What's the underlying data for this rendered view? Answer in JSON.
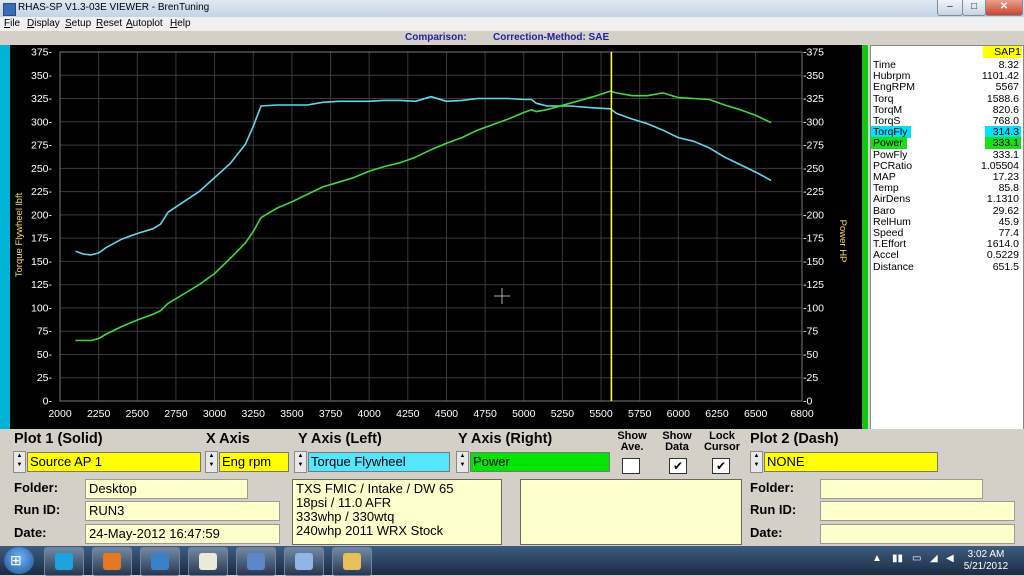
{
  "window": {
    "title": "RHAS-SP V1.3-03E VIEWER - BrenTuning",
    "controls": {
      "minimize": "–",
      "maximize": "□",
      "close": "✕"
    }
  },
  "menu": [
    "File",
    "Display",
    "Setup",
    "Reset",
    "Autoplot",
    "Help"
  ],
  "header": {
    "comparison": "Comparison:",
    "correction": "Correction-Method: SAE"
  },
  "chart_data": {
    "type": "line",
    "ylabel_left": "Torque Flywheel lbft",
    "ylabel_right": "Power HP",
    "xlim": [
      2000,
      6800
    ],
    "ylim": [
      0,
      375
    ],
    "x_ticks": [
      2000,
      2250,
      2500,
      2750,
      3000,
      3250,
      3500,
      3750,
      4000,
      4250,
      4500,
      4750,
      5000,
      5250,
      5500,
      5750,
      6000,
      6250,
      6500,
      6800
    ],
    "y_ticks": [
      0,
      25,
      50,
      75,
      100,
      125,
      150,
      175,
      200,
      225,
      250,
      275,
      300,
      325,
      350,
      375
    ],
    "cursor_x": 5567,
    "grid": true,
    "series": [
      {
        "name": "Torque Flywheel",
        "color": "#5fd7f2",
        "x": [
          2100,
          2150,
          2200,
          2250,
          2300,
          2400,
          2500,
          2600,
          2650,
          2700,
          2800,
          2900,
          3000,
          3100,
          3200,
          3250,
          3300,
          3400,
          3500,
          3600,
          3700,
          3800,
          3900,
          4000,
          4100,
          4200,
          4300,
          4400,
          4500,
          4600,
          4700,
          4800,
          4900,
          5000,
          5050,
          5080,
          5150,
          5300,
          5450,
          5560,
          5600,
          5700,
          5800,
          5900,
          6000,
          6100,
          6200,
          6300,
          6400,
          6500,
          6600
        ],
        "y": [
          161,
          158,
          157,
          159,
          165,
          174,
          180,
          185,
          190,
          203,
          214,
          225,
          240,
          255,
          276,
          295,
          317,
          318,
          318,
          318,
          321,
          322,
          322,
          322,
          323,
          323,
          322,
          327,
          322,
          323,
          325,
          325,
          325,
          324,
          324,
          320,
          317,
          317,
          315,
          314,
          309,
          303,
          298,
          291,
          283,
          279,
          272,
          262,
          254,
          246,
          237
        ]
      },
      {
        "name": "Power",
        "color": "#3ddc3d",
        "x": [
          2100,
          2150,
          2200,
          2250,
          2300,
          2400,
          2500,
          2600,
          2650,
          2700,
          2800,
          2900,
          3000,
          3100,
          3200,
          3250,
          3300,
          3400,
          3500,
          3600,
          3700,
          3800,
          3900,
          4000,
          4100,
          4200,
          4300,
          4400,
          4500,
          4600,
          4700,
          4800,
          4900,
          5000,
          5050,
          5080,
          5150,
          5300,
          5450,
          5560,
          5600,
          5700,
          5800,
          5900,
          6000,
          6100,
          6200,
          6300,
          6400,
          6500,
          6600
        ],
        "y": [
          65,
          65,
          65,
          67,
          72,
          80,
          87,
          93,
          97,
          105,
          115,
          125,
          137,
          153,
          170,
          182,
          197,
          207,
          214,
          222,
          230,
          235,
          240,
          247,
          252,
          256,
          262,
          270,
          277,
          283,
          291,
          297,
          303,
          310,
          313,
          311,
          313,
          320,
          327,
          333,
          331,
          328,
          328,
          331,
          326,
          325,
          324,
          318,
          313,
          307,
          299
        ]
      }
    ]
  },
  "data_panel": {
    "header": "SAP1",
    "rows": [
      {
        "label": "Time",
        "value": "8.32"
      },
      {
        "label": "Hubrpm",
        "value": "1101.42"
      },
      {
        "label": "EngRPM",
        "value": "5567"
      },
      {
        "label": "Torq",
        "value": "1588.6"
      },
      {
        "label": "TorqM",
        "value": "820.6"
      },
      {
        "label": "TorqS",
        "value": "768.0"
      },
      {
        "label": "TorqFly",
        "value": "314.3",
        "highlight": "#00e0ff"
      },
      {
        "label": "Power",
        "value": "333.1",
        "highlight": "#18e018"
      },
      {
        "label": "PowFly",
        "value": "333.1"
      },
      {
        "label": "PCRatio",
        "value": "1.05504"
      },
      {
        "label": "MAP",
        "value": "17.23"
      },
      {
        "label": "Temp",
        "value": "85.8"
      },
      {
        "label": "AirDens",
        "value": "1.1310"
      },
      {
        "label": "Baro",
        "value": "29.62"
      },
      {
        "label": "RelHum",
        "value": "45.9"
      },
      {
        "label": "Speed",
        "value": "77.4"
      },
      {
        "label": "T.Effort",
        "value": "1614.0"
      },
      {
        "label": "Accel",
        "value": "0.5229"
      },
      {
        "label": "Distance",
        "value": "651.5"
      }
    ]
  },
  "controls": {
    "plot1_header": "Plot 1 (Solid)",
    "xaxis_header": "X Axis",
    "yleft_header": "Y Axis (Left)",
    "yright_header": "Y Axis (Right)",
    "show_ave": [
      "Show",
      "Ave."
    ],
    "show_data": [
      "Show",
      "Data"
    ],
    "lock_cursor": [
      "Lock",
      "Cursor"
    ],
    "plot2_header": "Plot 2 (Dash)",
    "plot1_source": "Source AP 1",
    "xaxis_value": "Eng rpm",
    "yleft_value": "Torque Flywheel",
    "yright_value": "Power",
    "plot2_source": "NONE",
    "show_ave_checked": "",
    "show_data_checked": "✔",
    "lock_cursor_checked": "✔",
    "colors": {
      "yellow": "#ffff00",
      "cyan": "#55e6ff",
      "green": "#00e600"
    }
  },
  "file_info": {
    "folder_label": "Folder:",
    "folder": "Desktop",
    "runid_label": "Run ID:",
    "runid": "RUN3",
    "date_label": "Date:",
    "date": "24-May-2012   16:47:59",
    "notes": [
      "TXS FMIC / Intake / DW 65",
      "18psi / 11.0 AFR",
      "333whp / 330wtq",
      "240whp 2011 WRX Stock"
    ],
    "notes2": [],
    "plot2_folder_label": "Folder:",
    "plot2_runid_label": "Run ID:",
    "plot2_date_label": "Date:"
  },
  "taskbar": {
    "start_glyph": "⊞",
    "apps": [
      {
        "name": "skype",
        "color": "#1fa3e0"
      },
      {
        "name": "firefox",
        "color": "#e4791f"
      },
      {
        "name": "email",
        "color": "#3a82c8"
      },
      {
        "name": "notepad",
        "color": "#ece9d8"
      },
      {
        "name": "viewer",
        "color": "#5a87c8"
      },
      {
        "name": "tool",
        "color": "#8fb6e6"
      },
      {
        "name": "folder",
        "color": "#e6c15a"
      }
    ],
    "clock_time": "3:02 AM",
    "clock_date": "5/21/2012"
  }
}
